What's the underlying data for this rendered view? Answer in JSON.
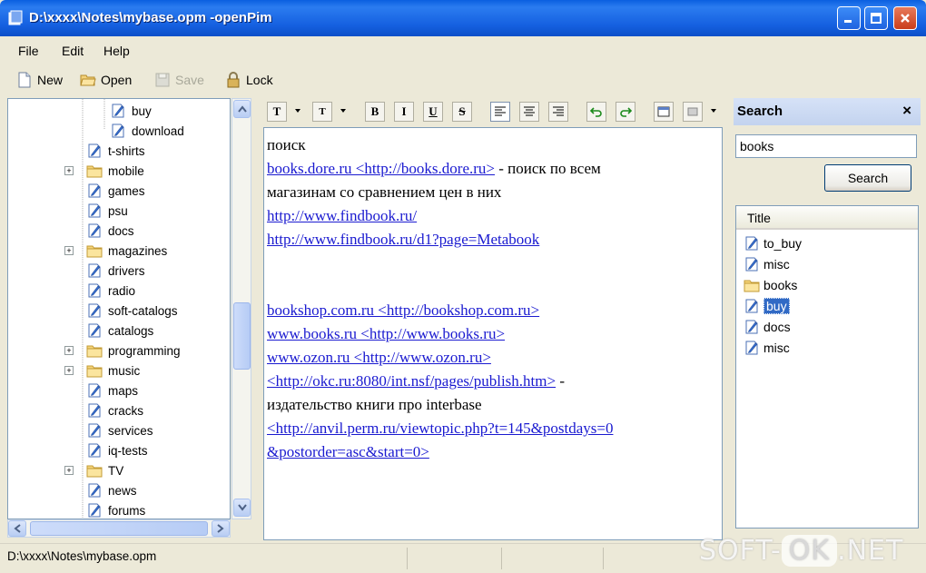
{
  "window": {
    "title": "D:\\xxxx\\Notes\\mybase.opm -openPim"
  },
  "menu": {
    "file": "File",
    "edit": "Edit",
    "help": "Help"
  },
  "toolbar": {
    "new": "New",
    "open": "Open",
    "save": "Save",
    "lock": "Lock"
  },
  "tree": {
    "items": [
      {
        "label": "buy",
        "type": "note",
        "level": 2,
        "expandable": false
      },
      {
        "label": "download",
        "type": "note",
        "level": 2,
        "expandable": false
      },
      {
        "label": "t-shirts",
        "type": "note",
        "level": 1,
        "expandable": false
      },
      {
        "label": "mobile",
        "type": "folder",
        "level": 1,
        "expandable": true
      },
      {
        "label": "games",
        "type": "note",
        "level": 1,
        "expandable": false
      },
      {
        "label": "psu",
        "type": "note",
        "level": 1,
        "expandable": false
      },
      {
        "label": "docs",
        "type": "note",
        "level": 1,
        "expandable": false
      },
      {
        "label": "magazines",
        "type": "folder",
        "level": 1,
        "expandable": true
      },
      {
        "label": "drivers",
        "type": "note",
        "level": 1,
        "expandable": false
      },
      {
        "label": "radio",
        "type": "note",
        "level": 1,
        "expandable": false
      },
      {
        "label": "soft-catalogs",
        "type": "note",
        "level": 1,
        "expandable": false
      },
      {
        "label": "catalogs",
        "type": "note",
        "level": 1,
        "expandable": false
      },
      {
        "label": "programming",
        "type": "folder",
        "level": 1,
        "expandable": true
      },
      {
        "label": "music",
        "type": "folder",
        "level": 1,
        "expandable": true
      },
      {
        "label": "maps",
        "type": "note",
        "level": 1,
        "expandable": false
      },
      {
        "label": "cracks",
        "type": "note",
        "level": 1,
        "expandable": false
      },
      {
        "label": "services",
        "type": "note",
        "level": 1,
        "expandable": false
      },
      {
        "label": "iq-tests",
        "type": "note",
        "level": 1,
        "expandable": false
      },
      {
        "label": "TV",
        "type": "folder",
        "level": 1,
        "expandable": true
      },
      {
        "label": "news",
        "type": "note",
        "level": 1,
        "expandable": false
      },
      {
        "label": "forums",
        "type": "note",
        "level": 1,
        "expandable": false
      }
    ]
  },
  "editor_toolbar": {
    "text_btn": "T",
    "bold": "B",
    "italic": "I",
    "underline": "U",
    "strike": "S"
  },
  "editor": {
    "lines": [
      [
        {
          "t": "поиск",
          "link": false
        }
      ],
      [
        {
          "t": "books.dore.ru <http://books.dore.ru>",
          "link": true
        },
        {
          "t": " - поиск по всем",
          "link": false
        }
      ],
      [
        {
          "t": "магазинам со сравнением цен в них",
          "link": false
        }
      ],
      [
        {
          "t": "http://www.findbook.ru/",
          "link": true
        }
      ],
      [
        {
          "t": "http://www.findbook.ru/d1?page=Metabook",
          "link": true
        }
      ],
      [],
      [],
      [
        {
          "t": "bookshop.com.ru <http://bookshop.com.ru>",
          "link": true
        }
      ],
      [
        {
          "t": "www.books.ru <http://www.books.ru>",
          "link": true
        }
      ],
      [
        {
          "t": "www.ozon.ru <http://www.ozon.ru>",
          "link": true
        }
      ],
      [
        {
          "t": "<http://okc.ru:8080/int.nsf/pages/publish.htm>",
          "link": true
        },
        {
          "t": " -",
          "link": false
        }
      ],
      [
        {
          "t": "издательство книги про interbase",
          "link": false
        }
      ],
      [
        {
          "t": " <http://anvil.perm.ru/viewtopic.php?t=145&postdays=0",
          "link": true
        }
      ],
      [
        {
          "t": "&postorder=asc&start=0>",
          "link": true
        }
      ]
    ]
  },
  "search": {
    "header": "Search",
    "close": "×",
    "query": "books",
    "button": "Search",
    "column_title": "Title",
    "results": [
      {
        "label": "to_buy",
        "type": "note",
        "selected": false
      },
      {
        "label": "misc",
        "type": "note",
        "selected": false
      },
      {
        "label": "books",
        "type": "folder",
        "selected": false
      },
      {
        "label": "buy",
        "type": "note",
        "selected": true
      },
      {
        "label": "docs",
        "type": "note",
        "selected": false
      },
      {
        "label": "misc",
        "type": "note",
        "selected": false
      }
    ]
  },
  "status": {
    "path": "D:\\xxxx\\Notes\\mybase.opm"
  },
  "watermark": {
    "left": "SOFT-",
    "ok": "OK",
    "right": ".NET"
  }
}
